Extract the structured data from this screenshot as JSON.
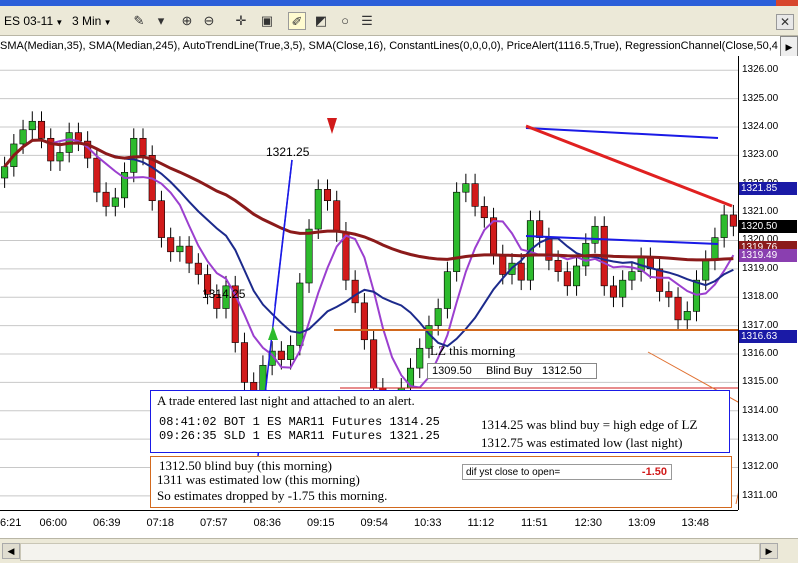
{
  "toolbar": {
    "instrument": "ES 03-11",
    "interval": "3 Min",
    "buttons": [
      "pencil-icon",
      "zoom-in-icon",
      "zoom-out-icon",
      "crosshair-icon",
      "properties-icon",
      "draw-icon",
      "chart-icon",
      "circle-icon",
      "list-icon"
    ]
  },
  "indicators_text": "SMA(Median,35), SMA(Median,245), AutoTrendLine(True,3,5), SMA(Close,16), ConstantLines(0,0,0,0), PriceAlert(1116.5,True), RegressionChannel(Close,50,4",
  "price_axis": {
    "ticks": [
      "1326.00",
      "1325.00",
      "1324.00",
      "1323.00",
      "1322.00",
      "1321.00",
      "1320.00",
      "1319.00",
      "1318.00",
      "1317.00",
      "1316.00",
      "1315.00",
      "1314.00",
      "1313.00",
      "1312.00",
      "1311.00"
    ],
    "labels": [
      {
        "text": "1321.85",
        "color": "#1a1aa6"
      },
      {
        "text": "1320.50",
        "color": "#000000"
      },
      {
        "text": "1319.76",
        "color": "#8b1a1a"
      },
      {
        "text": "1319.49",
        "color": "#8a3fb0"
      },
      {
        "text": "1316.63",
        "color": "#1a1aa6"
      }
    ]
  },
  "time_axis": [
    "6:21",
    "06:00",
    "06:39",
    "07:18",
    "07:57",
    "08:36",
    "09:15",
    "09:54",
    "10:33",
    "11:12",
    "11:51",
    "12:30",
    "13:09",
    "13:48"
  ],
  "chart_data": {
    "type": "candlestick",
    "ylim": [
      1310.5,
      1326.5
    ],
    "x_labels": [
      "6:21",
      "06:00",
      "06:39",
      "07:18",
      "07:57",
      "08:36",
      "09:15",
      "09:54",
      "10:33",
      "11:12",
      "11:51",
      "12:30",
      "13:09",
      "13:48"
    ],
    "close": [
      1322.6,
      1323.4,
      1323.9,
      1324.2,
      1323.6,
      1322.8,
      1323.1,
      1323.8,
      1323.5,
      1322.9,
      1321.7,
      1321.2,
      1321.5,
      1322.4,
      1323.6,
      1323.0,
      1321.4,
      1320.1,
      1319.6,
      1319.8,
      1319.2,
      1318.8,
      1318.1,
      1317.6,
      1318.4,
      1316.4,
      1315.0,
      1314.3,
      1315.6,
      1316.1,
      1315.8,
      1316.3,
      1318.5,
      1320.4,
      1321.8,
      1321.4,
      1320.3,
      1318.6,
      1317.8,
      1316.5,
      1314.8,
      1313.5,
      1314.1,
      1314.8,
      1315.5,
      1316.2,
      1317.0,
      1317.6,
      1318.9,
      1321.7,
      1322.0,
      1321.2,
      1320.8,
      1319.5,
      1318.8,
      1319.2,
      1318.6,
      1320.7,
      1320.1,
      1319.3,
      1318.9,
      1318.4,
      1319.1,
      1319.9,
      1320.5,
      1318.4,
      1318.0,
      1318.6,
      1318.9,
      1319.4,
      1319.0,
      1318.2,
      1318.0,
      1317.2,
      1317.5,
      1318.6,
      1319.3,
      1320.1,
      1320.9,
      1320.5
    ],
    "moving_averages": [
      {
        "name": "SMA(Median,35)",
        "color": "#1c2a8c"
      },
      {
        "name": "SMA(Median,245)",
        "color": "#8b1a1a"
      },
      {
        "name": "SMA(Close,16)",
        "color": "#9b3fcf"
      }
    ],
    "annotations": [
      "1321.25",
      "1314.25"
    ]
  },
  "notes": {
    "lz_label": "LZ this morning",
    "lz_price_left": "1309.50",
    "lz_blind_label": "Blind Buy",
    "lz_blind_price": "1312.50",
    "trade_header": "A trade entered last night and attached to an alert.",
    "trade_line1": "08:41:02 BOT 1 ES MAR11 Futures 1314.25",
    "trade_line2": "09:26:35 SLD 1 ES MAR11 Futures 1321.25",
    "side_line1": "1314.25 was blind buy = high edge of LZ",
    "side_line2": "1312.75 was estimated low (last night)",
    "morning_line1": "1312.50 blind buy (this morning)",
    "morning_line2": "1311 was estimated low (this morning)",
    "morning_line3": "So estimates dropped by -1.75 this morning.",
    "dif_label": "dif  yst close to open=",
    "dif_value": "-1.50"
  }
}
